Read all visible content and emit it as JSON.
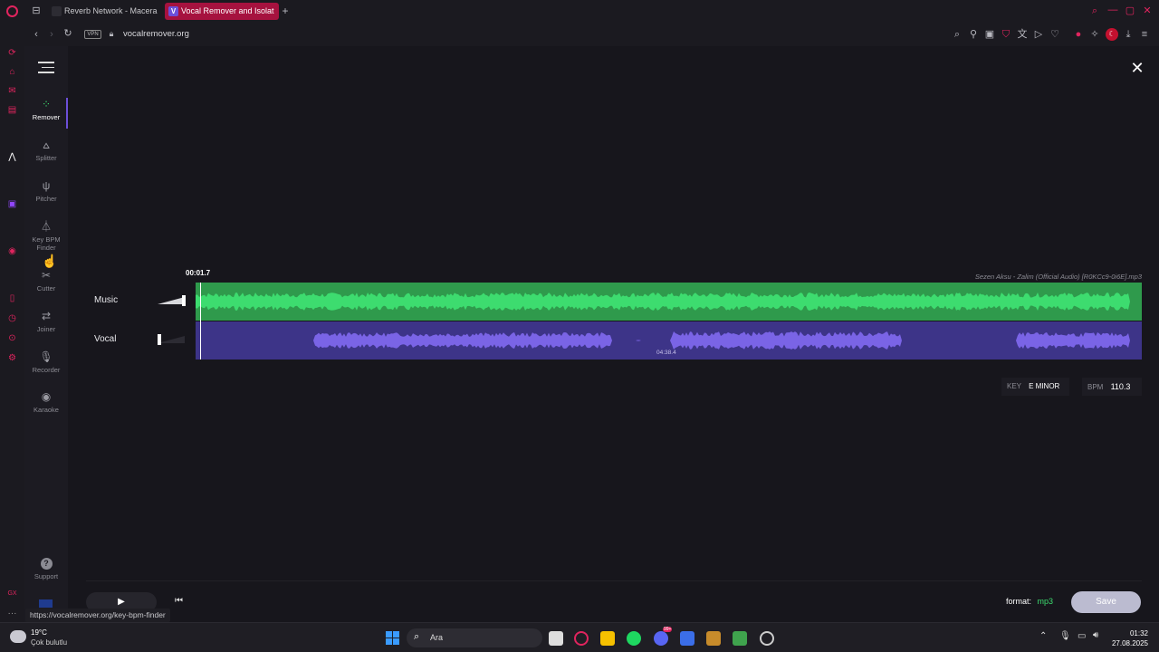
{
  "browser": {
    "tabs": [
      {
        "label": "Reverb Network - Macera",
        "active": false,
        "favicon_color": "#2d2c33"
      },
      {
        "label": "Vocal Remover and Isolat",
        "active": true,
        "favicon_letter": "V",
        "favicon_color": "#6c4fd8"
      }
    ],
    "new_tab": "+",
    "url": "vocalremover.org",
    "vpn_label": "VPN",
    "status_url": "https://vocalremover.org/key-bpm-finder"
  },
  "app": {
    "nav": [
      {
        "label": "Remover",
        "icon": "remover-icon",
        "active": true
      },
      {
        "label": "Splitter",
        "icon": "splitter-icon"
      },
      {
        "label": "Pitcher",
        "icon": "tuning-fork-icon"
      },
      {
        "label": "Key BPM Finder",
        "icon": "metronome-icon"
      },
      {
        "label": "Cutter",
        "icon": "scissors-icon"
      },
      {
        "label": "Joiner",
        "icon": "joiner-icon"
      },
      {
        "label": "Recorder",
        "icon": "microphone-icon"
      },
      {
        "label": "Karaoke",
        "icon": "disc-icon"
      }
    ],
    "support_label": "Support",
    "current_time": "00:01.7",
    "file_name": "Sezen Aksu - Zalim (Official Audio) [R0KCc9-0i6E].mp3",
    "tracks": [
      {
        "label": "Music",
        "volume": 1.0,
        "color": "#3ddc6f",
        "bg": "#2f9a4c"
      },
      {
        "label": "Vocal",
        "volume": 0.0,
        "color": "#7a64e6",
        "bg": "#3d3488"
      }
    ],
    "duration": "04:38.4",
    "key_label": "KEY",
    "key_value": "E MINOR",
    "bpm_label": "BPM",
    "bpm_value": "110.3",
    "format_label": "format:",
    "format_value": "mp3",
    "save_label": "Save"
  },
  "taskbar": {
    "weather_temp": "19°C",
    "weather_desc": "Çok bulutlu",
    "search_label": "Ara",
    "time": "01:32",
    "date": "27.08.2025",
    "badge": "99+"
  },
  "colors": {
    "accent_green": "#3ddc6f",
    "accent_purple": "#6c4fd8",
    "opera_red": "#e0245e"
  }
}
